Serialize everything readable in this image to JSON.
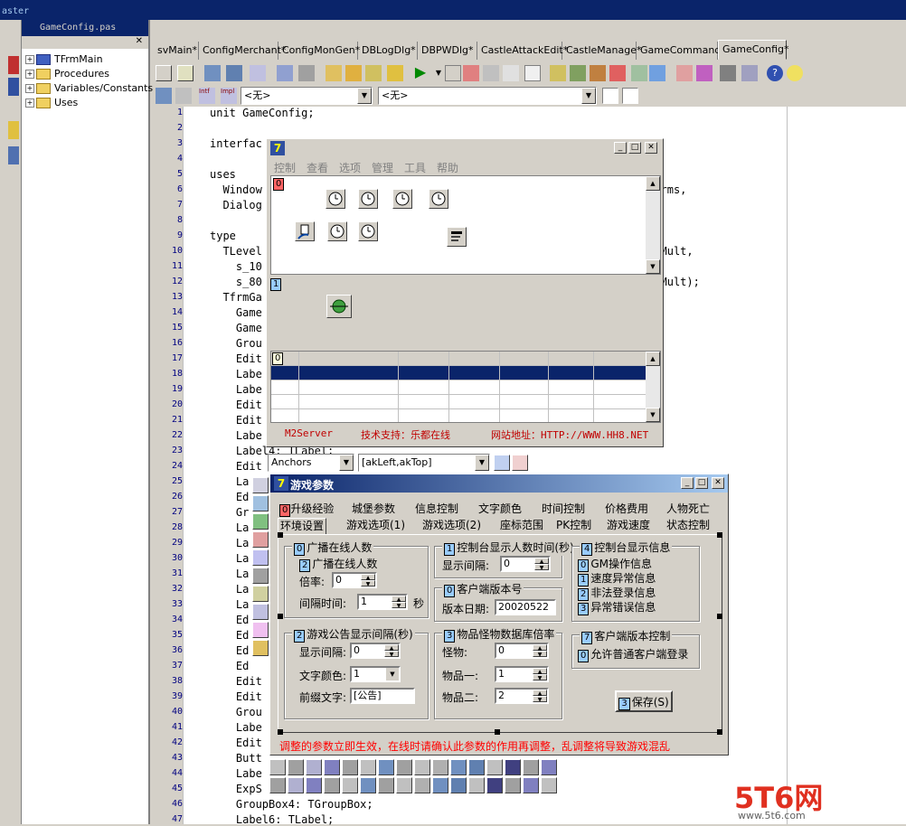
{
  "window": {
    "title": "aster"
  },
  "explorer": {
    "items": [
      {
        "label": "TFrmMain"
      },
      {
        "label": "Procedures"
      },
      {
        "label": "Variables/Constants"
      },
      {
        "label": "Uses"
      }
    ]
  },
  "editor": {
    "file_tab": "GameConfig.pas",
    "tabs": [
      "svMain*",
      "ConfigMerchant*",
      "ConfigMonGen*",
      "DBLogDlg*",
      "DBPWDlg*",
      "CastleAttackEdit*",
      "CastleManage*",
      "GameCommand*",
      "GameConfig*"
    ],
    "active_tab": "GameConfig*",
    "combo1": "<无>",
    "combo2": "<无>",
    "lines": [
      {
        "n": "1",
        "t": "unit GameConfig;"
      },
      {
        "n": "2",
        "t": ""
      },
      {
        "n": "3",
        "t": "interfac"
      },
      {
        "n": "4",
        "t": ""
      },
      {
        "n": "5",
        "t": "uses"
      },
      {
        "n": "6",
        "t": "  Window                                                   ntrols, Forms,"
      },
      {
        "n": "7",
        "t": "  Dialog"
      },
      {
        "n": "8",
        "t": ""
      },
      {
        "n": "9",
        "t": "type"
      },
      {
        "n": "10",
        "t": "  TLevel                                                  _6Mult, s_8Mult,"
      },
      {
        "n": "11",
        "t": "    s_10                                                   s_70Mult,"
      },
      {
        "n": "12",
        "t": "    s_80                                                  Mult, s_300Mult);"
      },
      {
        "n": "13",
        "t": "  TfrmGa"
      },
      {
        "n": "14",
        "t": "    Game"
      },
      {
        "n": "15",
        "t": "    Game"
      },
      {
        "n": "16",
        "t": "    Grou"
      },
      {
        "n": "17",
        "t": "    Edit"
      },
      {
        "n": "18",
        "t": "    Labe"
      },
      {
        "n": "19",
        "t": "    Labe"
      },
      {
        "n": "20",
        "t": "    Edit"
      },
      {
        "n": "21",
        "t": "    Edit"
      },
      {
        "n": "22",
        "t": "    Labe"
      },
      {
        "n": "23",
        "t": "    Label4: TLabel;"
      },
      {
        "n": "24",
        "t": "    Edit"
      },
      {
        "n": "25",
        "t": "    La"
      },
      {
        "n": "26",
        "t": "    Ed"
      },
      {
        "n": "27",
        "t": "    Gr"
      },
      {
        "n": "28",
        "t": "    La"
      },
      {
        "n": "29",
        "t": "    La"
      },
      {
        "n": "30",
        "t": "    La"
      },
      {
        "n": "31",
        "t": "    La"
      },
      {
        "n": "32",
        "t": "    La"
      },
      {
        "n": "33",
        "t": "    La"
      },
      {
        "n": "34",
        "t": "    Ed"
      },
      {
        "n": "35",
        "t": "    Ed"
      },
      {
        "n": "36",
        "t": "    Ed"
      },
      {
        "n": "37",
        "t": "    Ed"
      },
      {
        "n": "38",
        "t": "    Edit"
      },
      {
        "n": "39",
        "t": "    Edit"
      },
      {
        "n": "40",
        "t": "    Grou"
      },
      {
        "n": "41",
        "t": "    Labe"
      },
      {
        "n": "42",
        "t": "    Edit"
      },
      {
        "n": "43",
        "t": "    Butt"
      },
      {
        "n": "44",
        "t": "    Labe"
      },
      {
        "n": "45",
        "t": "    ExpS"
      },
      {
        "n": "46",
        "t": "    GroupBox4: TGroupBox;"
      },
      {
        "n": "47",
        "t": "    Label6: TLabel;"
      }
    ]
  },
  "form1": {
    "menu": [
      "控制",
      "查看",
      "选项",
      "管理",
      "工具",
      "帮助"
    ],
    "tag0": "0",
    "tag1": "1",
    "grid_tag": "0",
    "status": [
      "M2Server",
      "技术支持：乐都在线",
      "网站地址：HTTP://WWW.HH8.NET"
    ]
  },
  "anchors": {
    "label": "Anchors",
    "value": "[akLeft,akTop]"
  },
  "form2": {
    "title": "游戏参数",
    "tabs_row1": [
      "升级经验",
      "城堡参数",
      "信息控制",
      "文字颜色",
      "时间控制",
      "价格费用",
      "人物死亡"
    ],
    "tabs_row2": [
      "环境设置",
      "游戏选项(1)",
      "游戏选项(2)",
      "座标范围",
      "PK控制",
      "游戏速度",
      "状态控制"
    ],
    "tab_tag": "0",
    "broadcast": {
      "title": "广播在线人数",
      "check": "广播在线人数",
      "rate_label": "倍率:",
      "rate_value": "0",
      "interval_label": "间隔时间:",
      "interval_value": "1",
      "unit": "秒"
    },
    "console_time": {
      "title": "控制台显示人数时间(秒)",
      "label": "显示间隔:",
      "value": "0"
    },
    "console_info": {
      "title": "控制台显示信息",
      "items": [
        {
          "tag": "0",
          "label": "GM操作信息"
        },
        {
          "tag": "1",
          "label": "速度异常信息"
        },
        {
          "tag": "2",
          "label": "非法登录信息"
        },
        {
          "tag": "3",
          "label": "异常错误信息"
        }
      ]
    },
    "client_version": {
      "title": "客户端版本号",
      "label": "版本日期:",
      "value": "20020522"
    },
    "notice": {
      "title": "游戏公告显示间隔(秒)",
      "interval_label": "显示间隔:",
      "interval_value": "0",
      "color_label": "文字颜色:",
      "color_value": "1",
      "prefix_label": "前缀文字:",
      "prefix_value": "[公告]"
    },
    "drop_rate": {
      "title": "物品怪物数据库倍率",
      "rows": [
        {
          "label": "怪物:",
          "value": "0"
        },
        {
          "label": "物品一:",
          "value": "1"
        },
        {
          "label": "物品二:",
          "value": "2"
        }
      ]
    },
    "client_control": {
      "title": "客户端版本控制",
      "check": "允许普通客户端登录"
    },
    "save_button": "保存(S)",
    "warning": "调整的参数立即生效，在线时请确认此参数的作用再调整，乱调整将导致游戏混乱"
  },
  "watermark": {
    "brand": "5T6网",
    "sub": "www.5t6.com"
  },
  "colors": {
    "titlebar": "#0a246a",
    "grid_selected": "#0a246a",
    "warning": "#ff0000",
    "status_red": "#cc0000"
  }
}
